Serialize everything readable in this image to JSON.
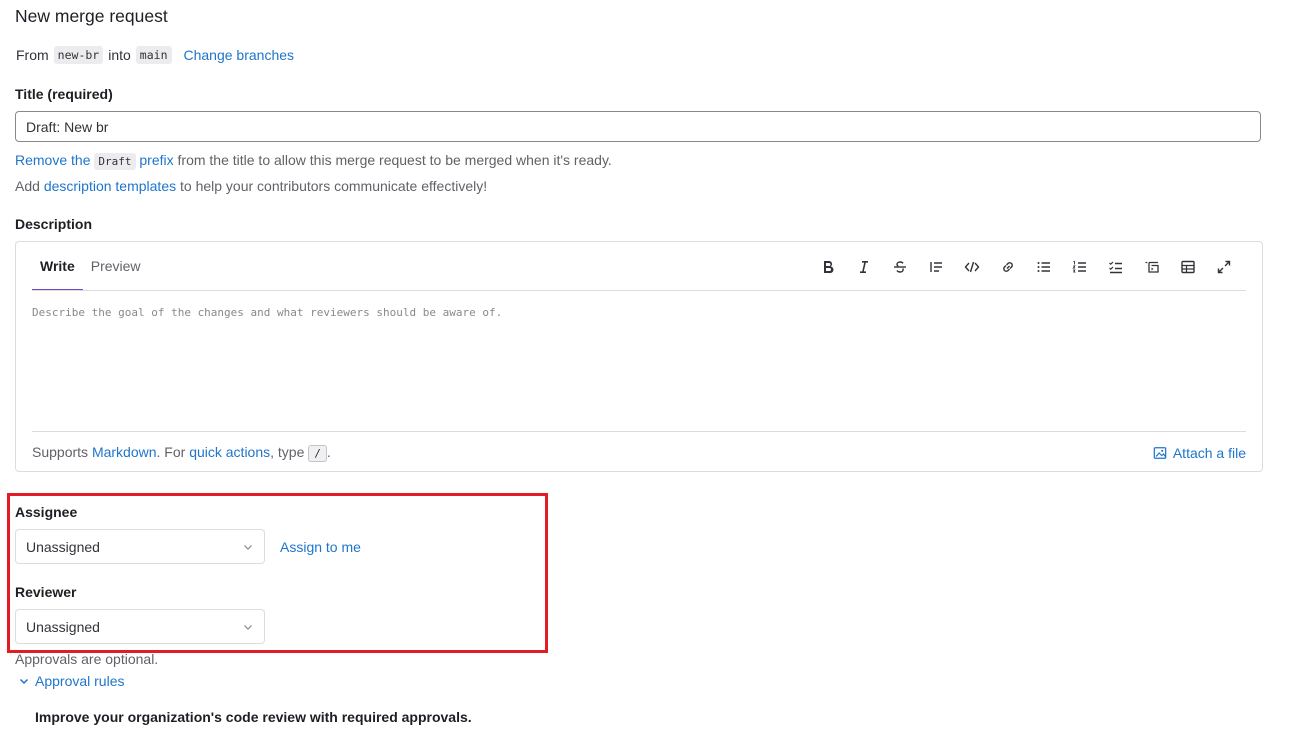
{
  "page": {
    "title": "New merge request"
  },
  "branches": {
    "from_label": "From",
    "source": "new-br",
    "into_label": "into",
    "target": "main",
    "change_link": "Change branches"
  },
  "title_field": {
    "label": "Title (required)",
    "value": "Draft: New br",
    "help_link": "Remove the",
    "help_code": "Draft",
    "help_link2": "prefix",
    "help_rest": "from the title to allow this merge request to be merged when it's ready."
  },
  "templates_help": {
    "prefix": "Add",
    "link": "description templates",
    "suffix": "to help your contributors communicate effectively!"
  },
  "description": {
    "label": "Description",
    "tabs": [
      {
        "label": "Write",
        "active": true
      },
      {
        "label": "Preview",
        "active": false
      }
    ],
    "toolbar": [
      "bold-icon",
      "italic-icon",
      "strikethrough-icon",
      "quote-icon",
      "code-icon",
      "link-icon",
      "bulleted-list-icon",
      "numbered-list-icon",
      "task-list-icon",
      "collapsible-section-icon",
      "table-icon",
      "fullscreen-icon"
    ],
    "placeholder": "Describe the goal of the changes and what reviewers should be aware of.",
    "supports_prefix": "Supports",
    "markdown_link": "Markdown",
    "for_text": ". For",
    "quick_actions_link": "quick actions",
    "type_text": ", type",
    "slash": "/",
    "period": ".",
    "attach_label": "Attach a file"
  },
  "assignee": {
    "label": "Assignee",
    "value": "Unassigned",
    "assign_to_me": "Assign to me"
  },
  "reviewer": {
    "label": "Reviewer",
    "value": "Unassigned"
  },
  "approvals": {
    "optional_text": "Approvals are optional.",
    "rules_label": "Approval rules",
    "improve_text": "Improve your organization's code review with required approvals."
  },
  "colors": {
    "link": "#1f75cb",
    "highlight": "#e31b23",
    "active_tab": "#6e49cb"
  }
}
